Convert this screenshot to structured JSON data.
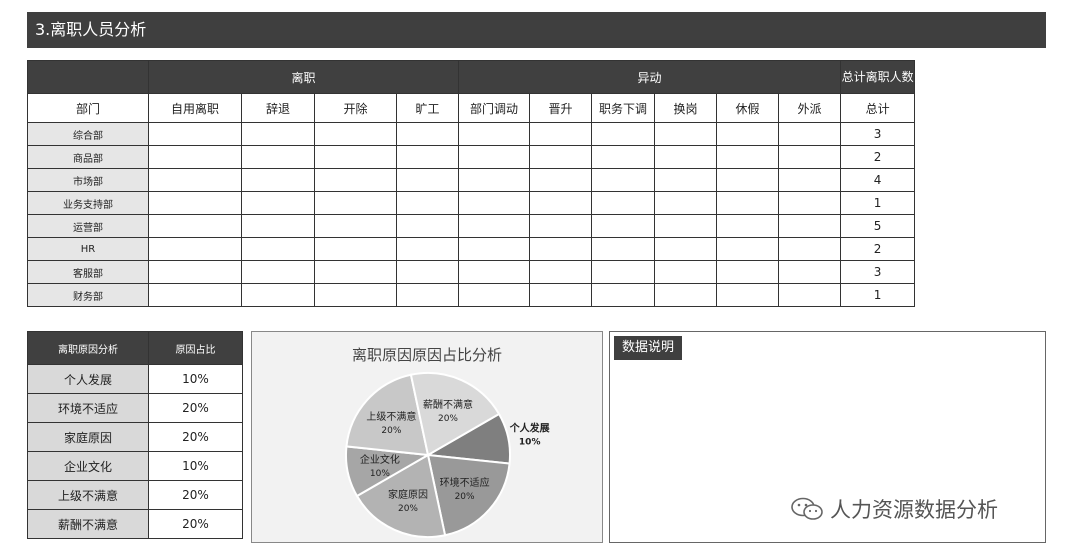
{
  "page_title": "3.离职人员分析",
  "main_table": {
    "group_headers": {
      "leave": "离职",
      "transfer": "异动",
      "total": "总计离职人数"
    },
    "columns": [
      "部门",
      "自用离职",
      "辞退",
      "开除",
      "旷工",
      "部门调动",
      "晋升",
      "职务下调",
      "换岗",
      "休假",
      "外派",
      "总计"
    ],
    "rows": [
      {
        "dept": "综合部",
        "total": "3"
      },
      {
        "dept": "商品部",
        "total": "2"
      },
      {
        "dept": "市场部",
        "total": "4"
      },
      {
        "dept": "业务支持部",
        "total": "1"
      },
      {
        "dept": "运营部",
        "total": "5"
      },
      {
        "dept": "HR",
        "total": "2"
      },
      {
        "dept": "客服部",
        "total": "3"
      },
      {
        "dept": "财务部",
        "total": "1"
      }
    ]
  },
  "reason_table": {
    "headers": [
      "离职原因分析",
      "原因占比"
    ],
    "rows": [
      {
        "reason": "个人发展",
        "share": "10%"
      },
      {
        "reason": "环境不适应",
        "share": "20%"
      },
      {
        "reason": "家庭原因",
        "share": "20%"
      },
      {
        "reason": "企业文化",
        "share": "10%"
      },
      {
        "reason": "上级不满意",
        "share": "20%"
      },
      {
        "reason": "薪酬不满意",
        "share": "20%"
      }
    ]
  },
  "chart_data": {
    "type": "pie",
    "title": "离职原因原因占比分析",
    "slices": [
      {
        "label": "个人发展",
        "value": 10,
        "display": "10%",
        "color": "#7f7f7f"
      },
      {
        "label": "环境不适应",
        "value": 20,
        "display": "20%",
        "color": "#999999"
      },
      {
        "label": "家庭原因",
        "value": 20,
        "display": "20%",
        "color": "#b3b3b3"
      },
      {
        "label": "企业文化",
        "value": 10,
        "display": "10%",
        "color": "#a6a6a6"
      },
      {
        "label": "上级不满意",
        "value": 20,
        "display": "20%",
        "color": "#c8c8c8"
      },
      {
        "label": "薪酬不满意",
        "value": 20,
        "display": "20%",
        "color": "#d9d9d9"
      }
    ],
    "start_angle_deg": -30,
    "direction": "clockwise"
  },
  "notes": {
    "label": "数据说明"
  },
  "watermark": {
    "text": "人力资源数据分析",
    "icon": "wechat-icon"
  },
  "colors": {
    "header_dark": "#404040",
    "dept_cell": "#e6e6e6",
    "reason_cell": "#d9d9d9"
  }
}
